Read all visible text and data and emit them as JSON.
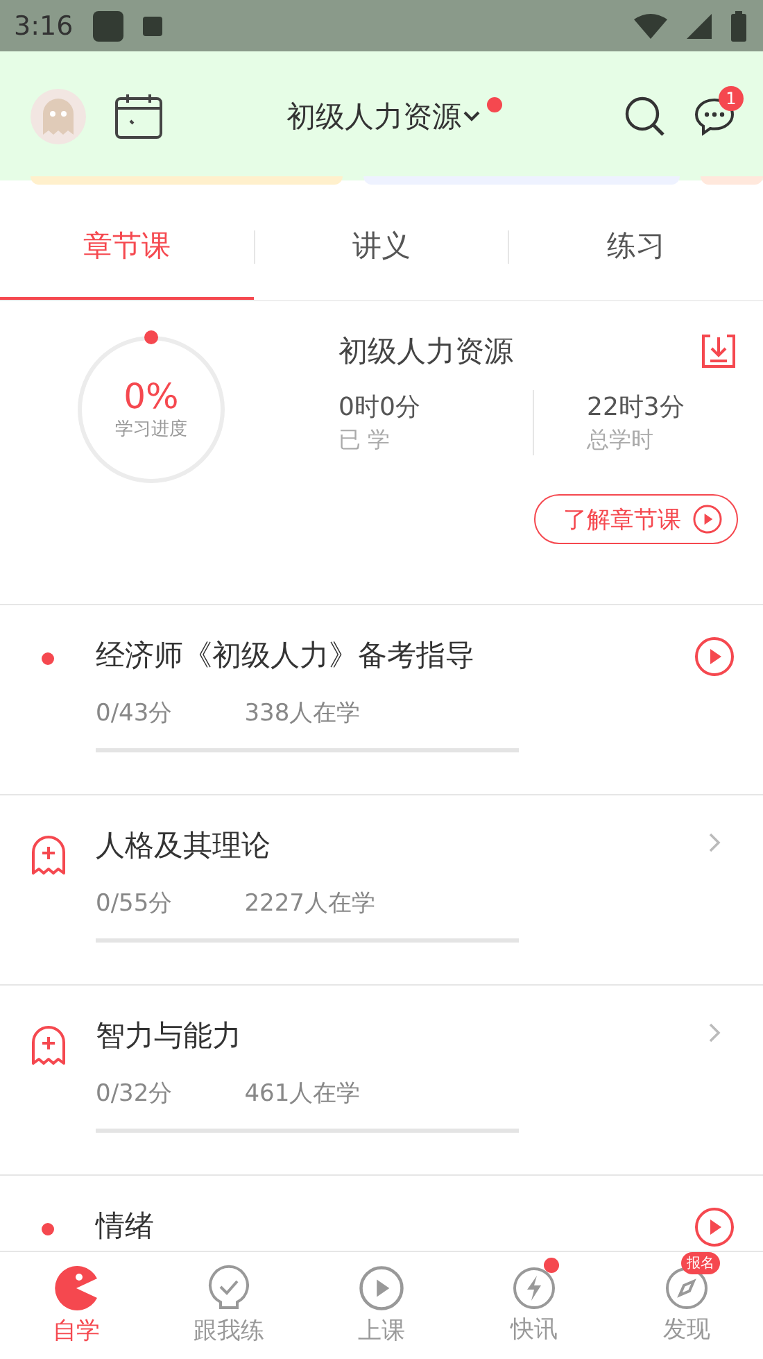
{
  "status_bar": {
    "time": "3:16"
  },
  "header": {
    "title": "初级人力资源",
    "title_dot": true,
    "message_badge": "1"
  },
  "tabs": [
    {
      "label": "章节课",
      "selected": true
    },
    {
      "label": "讲义",
      "selected": false
    },
    {
      "label": "练习",
      "selected": false
    }
  ],
  "progress": {
    "percent": "0%",
    "caption": "学习进度",
    "course": "初级人力资源",
    "studied_value": "0时0分",
    "studied_label": "已 学",
    "total_value": "22时3分",
    "total_label": "总学时",
    "intro_button": "了解章节课"
  },
  "courses": [
    {
      "kind": "intro",
      "title": "经济师《初级人力》备考指导",
      "score": "0/43分",
      "learners": "338人在学"
    },
    {
      "kind": "chapter",
      "title": "人格及其理论",
      "score": "0/55分",
      "learners": "2227人在学"
    },
    {
      "kind": "chapter",
      "title": "智力与能力",
      "score": "0/32分",
      "learners": "461人在学"
    },
    {
      "kind": "intro",
      "title": "情绪"
    }
  ],
  "bottom_nav": [
    {
      "label": "自学",
      "selected": true
    },
    {
      "label": "跟我练",
      "selected": false
    },
    {
      "label": "上课",
      "selected": false
    },
    {
      "label": "快讯",
      "selected": false,
      "dot": true
    },
    {
      "label": "发现",
      "selected": false,
      "badge": "报名"
    }
  ]
}
